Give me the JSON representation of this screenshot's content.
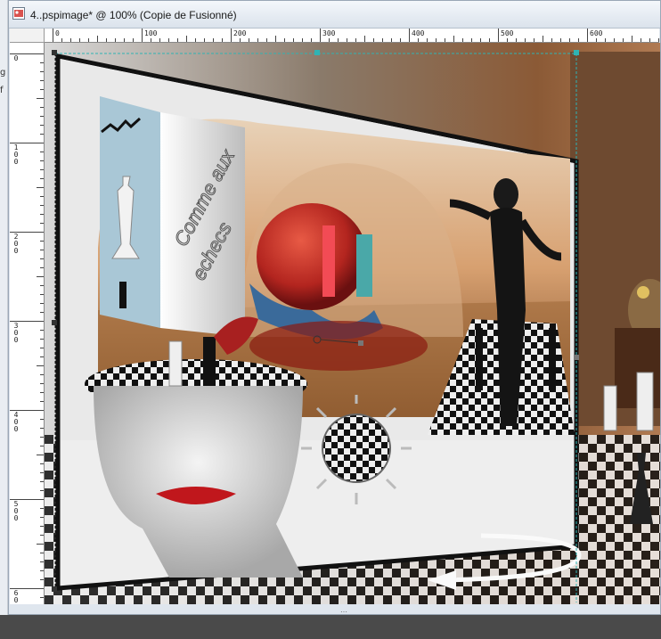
{
  "window": {
    "title": "4..pspimage* @ 100% (Copie de Fusionné)"
  },
  "ruler_top_labels": [
    "0",
    "100",
    "200",
    "300",
    "400",
    "500",
    "600"
  ],
  "ruler_left_labels": [
    "0",
    "1\n0\n0",
    "2\n0\n0",
    "3\n0\n0",
    "4\n0\n0",
    "5\n0\n0",
    "6\n0\n0"
  ],
  "artwork": {
    "text_line1": "Comme aux",
    "text_line2": "echecs"
  },
  "left_panel_letters": [
    "g",
    "f"
  ],
  "icons": {
    "document_icon": "pspimage-document-icon",
    "rotate_arrow": "curved-arrow-icon"
  },
  "colors": {
    "title_bar": "#dbe3ec",
    "canvas_bg": "#8a8a8a",
    "selection_guide": "#2fb3b3",
    "lips": "#c0171c",
    "apple": "#b3251f"
  }
}
